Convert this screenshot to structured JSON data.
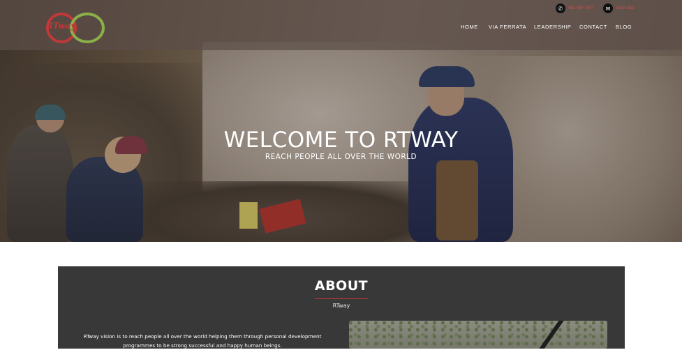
{
  "header": {
    "logo_text": "RTway",
    "phone": "082 567 7007",
    "email_label": "Send Mail",
    "nav": [
      "HOME",
      "VIA FERRATA",
      "LEADERSHIP",
      "CONTACT",
      "BLOG"
    ]
  },
  "hero": {
    "title": "WELCOME TO RTWAY",
    "subtitle": "REACH PEOPLE ALL OVER THE WORLD"
  },
  "about": {
    "title": "ABOUT",
    "subtitle": "RTway",
    "text": "RTway vision is to reach people all over the world helping them through personal development programmes to be strong successful and happy human beings."
  },
  "colors": {
    "accent_red": "#c0393a",
    "accent_green": "#8ab04a",
    "about_bg": "#383838"
  },
  "icons": {
    "phone": "phone-icon",
    "mail": "envelope-icon"
  }
}
